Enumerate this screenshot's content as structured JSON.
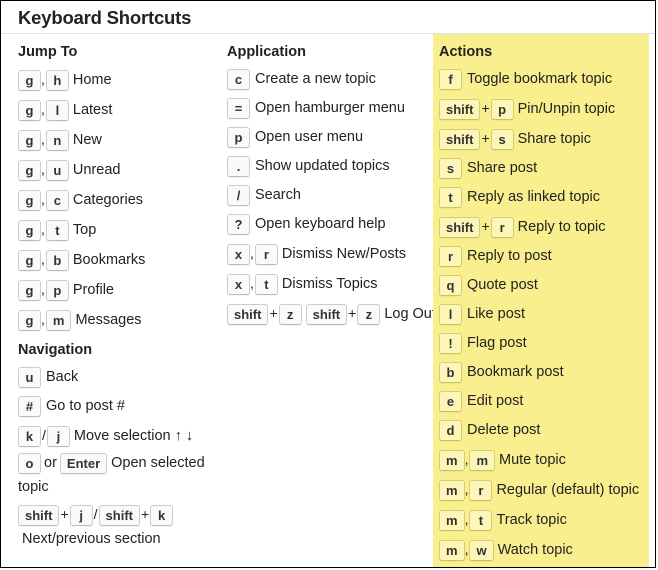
{
  "header": {
    "title": "Keyboard Shortcuts"
  },
  "colors": {
    "highlight": "#faef8f",
    "key_bg": "#fafafa",
    "key_border": "#cccccc",
    "text": "#222222"
  },
  "columns": {
    "jump_to": {
      "title": "Jump To",
      "items": [
        {
          "keys": [
            "g",
            "h"
          ],
          "joiner": ",",
          "label": "Home"
        },
        {
          "keys": [
            "g",
            "l"
          ],
          "joiner": ",",
          "label": "Latest"
        },
        {
          "keys": [
            "g",
            "n"
          ],
          "joiner": ",",
          "label": "New"
        },
        {
          "keys": [
            "g",
            "u"
          ],
          "joiner": ",",
          "label": "Unread"
        },
        {
          "keys": [
            "g",
            "c"
          ],
          "joiner": ",",
          "label": "Categories"
        },
        {
          "keys": [
            "g",
            "t"
          ],
          "joiner": ",",
          "label": "Top"
        },
        {
          "keys": [
            "g",
            "b"
          ],
          "joiner": ",",
          "label": "Bookmarks"
        },
        {
          "keys": [
            "g",
            "p"
          ],
          "joiner": ",",
          "label": "Profile"
        },
        {
          "keys": [
            "g",
            "m"
          ],
          "joiner": ",",
          "label": "Messages"
        }
      ]
    },
    "navigation": {
      "title": "Navigation",
      "items": [
        {
          "keys": [
            "u"
          ],
          "joiner": "",
          "label": "Back"
        },
        {
          "keys": [
            "#"
          ],
          "joiner": "",
          "label": "Go to post #"
        },
        {
          "keys": [
            "k",
            "j"
          ],
          "joiner": "/",
          "label": "Move selection ↑ ↓"
        },
        {
          "keys": [
            "o",
            "Enter"
          ],
          "joiner": "or",
          "label": "Open selected topic"
        },
        {
          "keys": [
            "shift",
            "j",
            "shift",
            "k"
          ],
          "joiner": "+/+",
          "label": "Next/previous section"
        }
      ]
    },
    "application": {
      "title": "Application",
      "items": [
        {
          "keys": [
            "c"
          ],
          "joiner": "",
          "label": "Create a new topic"
        },
        {
          "keys": [
            "="
          ],
          "joiner": "",
          "label": "Open hamburger menu"
        },
        {
          "keys": [
            "p"
          ],
          "joiner": "",
          "label": "Open user menu"
        },
        {
          "keys": [
            "."
          ],
          "joiner": "",
          "label": "Show updated topics"
        },
        {
          "keys": [
            "/"
          ],
          "joiner": "",
          "label": "Search"
        },
        {
          "keys": [
            "?"
          ],
          "joiner": "",
          "label": "Open keyboard help"
        },
        {
          "keys": [
            "x",
            "r"
          ],
          "joiner": ",",
          "label": "Dismiss New/Posts"
        },
        {
          "keys": [
            "x",
            "t"
          ],
          "joiner": ",",
          "label": "Dismiss Topics"
        },
        {
          "keys": [
            "shift",
            "z",
            "shift",
            "z"
          ],
          "joiner": "+ +",
          "label": "Log Out"
        }
      ]
    },
    "actions": {
      "title": "Actions",
      "items": [
        {
          "keys": [
            "f"
          ],
          "joiner": "",
          "label": "Toggle bookmark topic"
        },
        {
          "keys": [
            "shift",
            "p"
          ],
          "joiner": "+",
          "label": "Pin/Unpin topic"
        },
        {
          "keys": [
            "shift",
            "s"
          ],
          "joiner": "+",
          "label": "Share topic"
        },
        {
          "keys": [
            "s"
          ],
          "joiner": "",
          "label": "Share post"
        },
        {
          "keys": [
            "t"
          ],
          "joiner": "",
          "label": "Reply as linked topic"
        },
        {
          "keys": [
            "shift",
            "r"
          ],
          "joiner": "+",
          "label": "Reply to topic"
        },
        {
          "keys": [
            "r"
          ],
          "joiner": "",
          "label": "Reply to post"
        },
        {
          "keys": [
            "q"
          ],
          "joiner": "",
          "label": "Quote post"
        },
        {
          "keys": [
            "l"
          ],
          "joiner": "",
          "label": "Like post"
        },
        {
          "keys": [
            "!"
          ],
          "joiner": "",
          "label": "Flag post"
        },
        {
          "keys": [
            "b"
          ],
          "joiner": "",
          "label": "Bookmark post"
        },
        {
          "keys": [
            "e"
          ],
          "joiner": "",
          "label": "Edit post"
        },
        {
          "keys": [
            "d"
          ],
          "joiner": "",
          "label": "Delete post"
        },
        {
          "keys": [
            "m",
            "m"
          ],
          "joiner": ",",
          "label": "Mute topic"
        },
        {
          "keys": [
            "m",
            "r"
          ],
          "joiner": ",",
          "label": "Regular (default) topic"
        },
        {
          "keys": [
            "m",
            "t"
          ],
          "joiner": ",",
          "label": "Track topic"
        },
        {
          "keys": [
            "m",
            "w"
          ],
          "joiner": ",",
          "label": "Watch topic"
        }
      ]
    }
  }
}
